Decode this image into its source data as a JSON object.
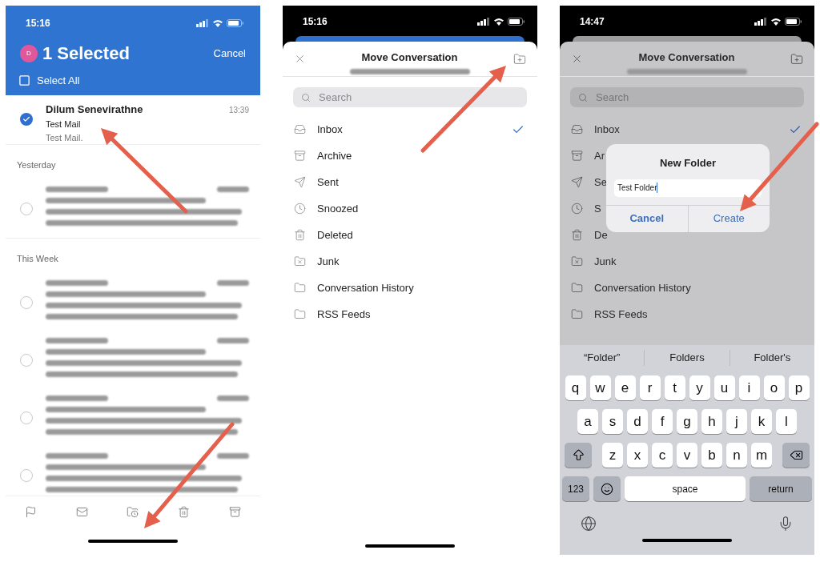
{
  "mail_list": {
    "status_time": "15:16",
    "avatar_initial": "D",
    "title": "1 Selected",
    "cancel": "Cancel",
    "select_all": "Select All",
    "items": [
      {
        "kind": "message",
        "sender": "Dilum Senevirathne",
        "time": "13:39",
        "subject": "Test Mail",
        "preview": "Test Mail.",
        "selected": true
      },
      {
        "kind": "section",
        "label": "Yesterday"
      },
      {
        "kind": "blurred",
        "selected": false
      },
      {
        "kind": "section",
        "label": "This Week"
      },
      {
        "kind": "blurred",
        "selected": false
      },
      {
        "kind": "blurred",
        "selected": false
      },
      {
        "kind": "blurred",
        "selected": false
      },
      {
        "kind": "blurred",
        "selected": false
      }
    ]
  },
  "move_sheet": {
    "status_time": "15:16",
    "title": "Move Conversation",
    "search": {
      "placeholder": "Search"
    },
    "folders": [
      {
        "kind": "inbox",
        "label": "Inbox",
        "selected": true
      },
      {
        "kind": "archive",
        "label": "Archive",
        "selected": false
      },
      {
        "kind": "sent",
        "label": "Sent",
        "selected": false
      },
      {
        "kind": "snoozed",
        "label": "Snoozed",
        "selected": false
      },
      {
        "kind": "deleted",
        "label": "Deleted",
        "selected": false
      },
      {
        "kind": "junk",
        "label": "Junk",
        "selected": false
      },
      {
        "kind": "folder",
        "label": "Conversation History",
        "selected": false
      },
      {
        "kind": "folder",
        "label": "RSS Feeds",
        "selected": false
      }
    ]
  },
  "new_folder_screen": {
    "status_time": "14:47",
    "title": "Move Conversation",
    "search": {
      "placeholder": "Search"
    },
    "folders": [
      {
        "kind": "inbox",
        "label": "Inbox",
        "selected": true
      },
      {
        "kind": "archive",
        "label": "Ar",
        "selected": false
      },
      {
        "kind": "sent",
        "label": "Se",
        "selected": false
      },
      {
        "kind": "snoozed",
        "label": "S",
        "selected": false
      },
      {
        "kind": "deleted",
        "label": "De",
        "selected": false
      },
      {
        "kind": "junk",
        "label": "Junk",
        "selected": false
      },
      {
        "kind": "folder",
        "label": "Conversation History",
        "selected": false
      },
      {
        "kind": "folder",
        "label": "RSS Feeds",
        "selected": false
      }
    ],
    "dialog": {
      "title": "New Folder",
      "value": "Test Folder",
      "buttons": [
        "Cancel",
        "Create"
      ]
    },
    "keyboard": {
      "suggestions": [
        "“Folder”",
        "Folders",
        "Folder's"
      ],
      "rows": [
        [
          "q",
          "w",
          "e",
          "r",
          "t",
          "y",
          "u",
          "i",
          "o",
          "p"
        ],
        [
          "a",
          "s",
          "d",
          "f",
          "g",
          "h",
          "j",
          "k",
          "l"
        ],
        [
          "z",
          "x",
          "c",
          "v",
          "b",
          "n",
          "m"
        ]
      ],
      "number_key": "123",
      "space": "space",
      "return": "return"
    }
  }
}
